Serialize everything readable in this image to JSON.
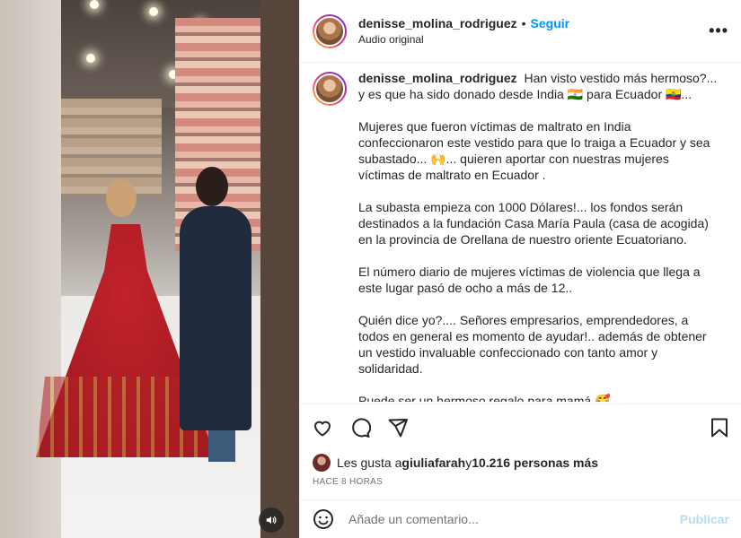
{
  "post": {
    "author": "denisse_molina_rodriguez",
    "separator": "•",
    "follow_label": "Seguir",
    "audio_label": "Audio original",
    "more_label": "•••"
  },
  "caption": {
    "author": "denisse_molina_rodriguez",
    "p1": "Han visto vestido más hermoso?... y es que ha sido donado desde India 🇮🇳 para Ecuador 🇪🇨...",
    "p2": "Mujeres que fueron víctimas de maltrato en India confeccionaron este vestido para que lo traiga a Ecuador y sea subastado... 🙌... quieren aportar con nuestras mujeres víctimas de maltrato en Ecuador .",
    "p3": "La subasta empieza con 1000 Dólares!... los fondos serán destinados a la fundación Casa María Paula (casa de acogida) en la provincia de Orellana de nuestro oriente Ecuatoriano.",
    "p4": "El número diario de mujeres víctimas de violencia que llega a este lugar pasó de ocho a más de 12..",
    "p5": "Quién dice yo?.... Señores empresarios, emprendedores, a todos en general es momento de ayudar!.. además de obtener un vestido invaluable confeccionado con tanto amor y solidaridad.",
    "p6": "Puede ser un hermoso regalo para mamá 🥰"
  },
  "actions": {
    "like_icon": "heart-icon",
    "comment_icon": "comment-icon",
    "share_icon": "share-icon",
    "save_icon": "bookmark-icon"
  },
  "likes": {
    "prefix": "Les gusta a ",
    "user": "giuliafarah",
    "middle": " y ",
    "count": "10.216 personas más"
  },
  "timestamp": "HACE 8 HORAS",
  "comment": {
    "placeholder": "Añade un comentario...",
    "publish_label": "Publicar"
  },
  "media": {
    "audio_icon": "volume-icon"
  },
  "colors": {
    "accent": "#0095f6",
    "publish_disabled": "#b2dffc",
    "text": "#262626",
    "muted": "#737373"
  }
}
